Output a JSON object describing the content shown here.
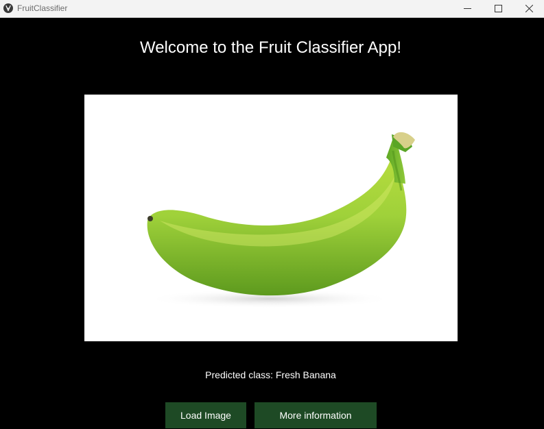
{
  "window": {
    "title": "FruitClassifier"
  },
  "main": {
    "heading": "Welcome to the Fruit Classifier App!",
    "image": {
      "subject": "banana",
      "background_color": "#ffffff"
    },
    "prediction_text": "Predicted class: Fresh Banana",
    "buttons": {
      "load_image": "Load Image",
      "more_info": "More information"
    }
  },
  "colors": {
    "background": "#000000",
    "button": "#1e4a25",
    "titlebar": "#f3f3f3"
  },
  "icons": {
    "app": "app-logo-icon",
    "minimize": "minimize-icon",
    "maximize": "maximize-icon",
    "close": "close-icon"
  }
}
